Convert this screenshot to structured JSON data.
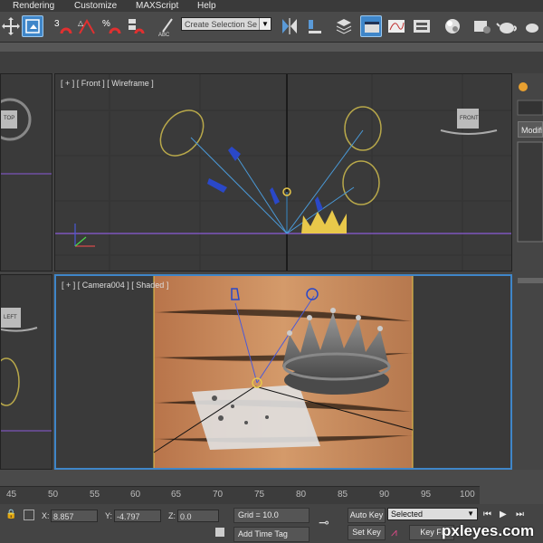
{
  "menu": [
    "Rendering",
    "Customize",
    "MAXScript",
    "Help"
  ],
  "toolbar": {
    "selection_set_label": "Create Selection Se",
    "dropdown_arrow": "▼",
    "icons": [
      "move-icon",
      "select-object-icon",
      "snap-3-icon",
      "angle-snap-icon",
      "percent-snap-icon",
      "spinner-snap-icon",
      "edit-named-selection-icon",
      "mirror-icon",
      "align-icon",
      "layer-manager-icon",
      "graphite-ribbon-icon",
      "curve-editor-icon",
      "schematic-view-icon",
      "material-editor-icon",
      "render-setup-icon",
      "render-frame-icon",
      "render-teapot-icon"
    ]
  },
  "viewports": {
    "front": {
      "label": "[ + ] [ Front ] [ Wireframe ]",
      "nav_cube_label": "FRONT"
    },
    "top": {
      "nav_cube_label": "TOP"
    },
    "camera": {
      "label": "[ + ] [ Camera004 ] [ Shaded ]"
    },
    "left": {
      "nav_cube_label": "LEFT"
    }
  },
  "command_panel": {
    "modifier_label": "Modifi"
  },
  "timeline": {
    "ticks": [
      "45",
      "50",
      "55",
      "60",
      "65",
      "70",
      "75",
      "80",
      "85",
      "90",
      "95",
      "100"
    ]
  },
  "status": {
    "x_label": "X:",
    "x_value": "8.857",
    "y_label": "Y:",
    "y_value": "-4.797",
    "z_label": "Z:",
    "z_value": "0.0",
    "grid": "Grid = 10.0",
    "add_time_tag": "Add Time Tag",
    "auto_key": "Auto Key",
    "set_key": "Set Key",
    "selected": "Selected",
    "key_filters": "Key Fi"
  },
  "watermark": "pxleyes.com",
  "colors": {
    "accent_blue": "#3f86c9",
    "viewport_bg": "#3a3a3a",
    "wood": "#c8845a",
    "crown_gold": "#e8c84a"
  }
}
